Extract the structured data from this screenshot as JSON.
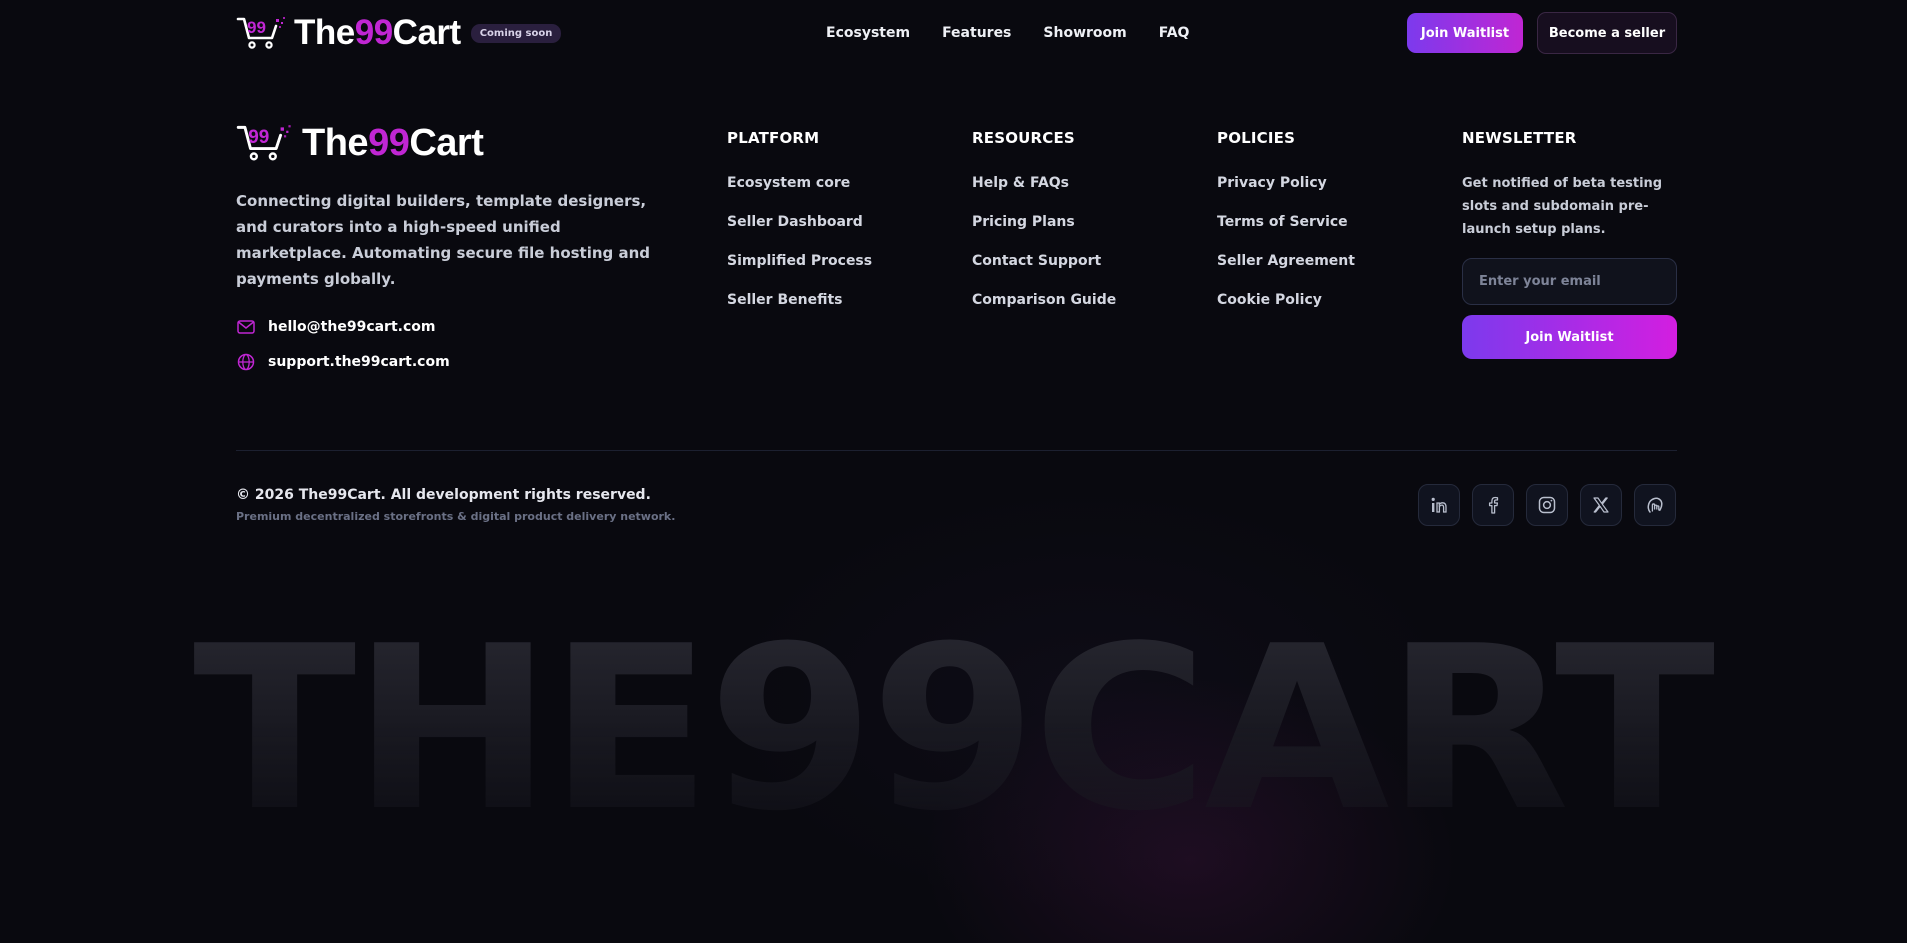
{
  "header": {
    "brand": {
      "prefix": "The",
      "accent": "99",
      "suffix": "Cart"
    },
    "badge": "Coming soon",
    "nav": [
      "Ecosystem",
      "Features",
      "Showroom",
      "FAQ"
    ],
    "join_label": "Join Waitlist",
    "seller_label": "Become a seller"
  },
  "footer": {
    "brand": {
      "prefix": "The",
      "accent": "99",
      "suffix": "Cart"
    },
    "tagline": "Connecting digital builders, template designers, and curators into a high-speed unified marketplace. Automating secure file hosting and payments globally.",
    "contacts": {
      "email": {
        "icon": "mail-icon",
        "text": "hello@the99cart.com"
      },
      "support": {
        "icon": "globe-icon",
        "text": "support.the99cart.com"
      }
    },
    "platform": {
      "title": "PLATFORM",
      "links": [
        "Ecosystem core",
        "Seller Dashboard",
        "Simplified Process",
        "Seller Benefits"
      ]
    },
    "resources": {
      "title": "RESOURCES",
      "links": [
        "Help & FAQs",
        "Pricing Plans",
        "Contact Support",
        "Comparison Guide"
      ]
    },
    "policies": {
      "title": "POLICIES",
      "links": [
        "Privacy Policy",
        "Terms of Service",
        "Seller Agreement",
        "Cookie Policy"
      ]
    },
    "newsletter": {
      "title": "NEWSLETTER",
      "description": "Get notified of beta testing slots and subdomain pre-launch setup plans.",
      "placeholder": "Enter your email",
      "button": "Join Waitlist"
    },
    "copyright": "© 2026 The99Cart. All development rights reserved.",
    "subline": "Premium decentralized storefronts & digital product delivery network.",
    "socials": [
      "linkedin-icon",
      "facebook-icon",
      "instagram-icon",
      "x-icon",
      "hand-icon"
    ],
    "watermark": "THE99CART"
  },
  "colors": {
    "background": "#09090f",
    "accent": "#c026d3",
    "gradient_start": "#7c3aed",
    "gradient_end": "#c026d3"
  }
}
